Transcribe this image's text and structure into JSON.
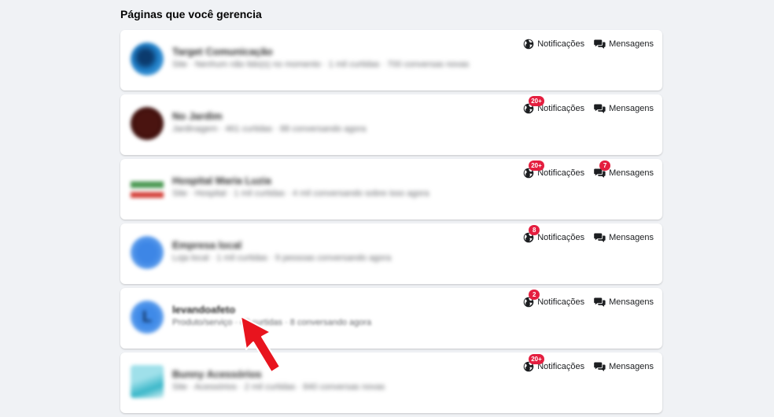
{
  "section_title": "Páginas que você gerencia",
  "labels": {
    "notifications": "Notificações",
    "messages": "Mensagens"
  },
  "icons": {
    "notifications": "globe-icon",
    "messages": "chat-bubbles-icon"
  },
  "colors": {
    "badge": "#e41e3f",
    "background": "#f0f2f5",
    "arrow": "#e8141e"
  },
  "pages": [
    {
      "name": "Target Comunicação",
      "meta": "Site · Nenhum não lido(s) no momento · 1 mil curtidas · 700 conversas novas",
      "avatar_letter": "",
      "notifications_badge": "",
      "messages_badge": ""
    },
    {
      "name": "No Jardim",
      "meta": "Jardinagem · 461 curtidas · 88 conversando agora",
      "avatar_letter": "",
      "notifications_badge": "20+",
      "messages_badge": ""
    },
    {
      "name": "Hospital Maria Luzia",
      "meta": "Site · Hospital · 1 mil curtidas · 4 mil conversando sobre isso agora",
      "avatar_letter": "",
      "notifications_badge": "20+",
      "messages_badge": "7"
    },
    {
      "name": "Empresa local",
      "meta": "Loja local · 1 mil curtidas · 9 pessoas conversando agora",
      "avatar_letter": "",
      "notifications_badge": "8",
      "messages_badge": ""
    },
    {
      "name": "levandoafeto",
      "meta": "Produto/serviço · 43 curtidas · 8 conversando agora",
      "avatar_letter": "L",
      "notifications_badge": "2",
      "messages_badge": ""
    },
    {
      "name": "Bunny Acessórios",
      "meta": "Site · Acessórios · 2 mil curtidas · 840 conversas novas",
      "avatar_letter": "",
      "notifications_badge": "20+",
      "messages_badge": ""
    }
  ]
}
